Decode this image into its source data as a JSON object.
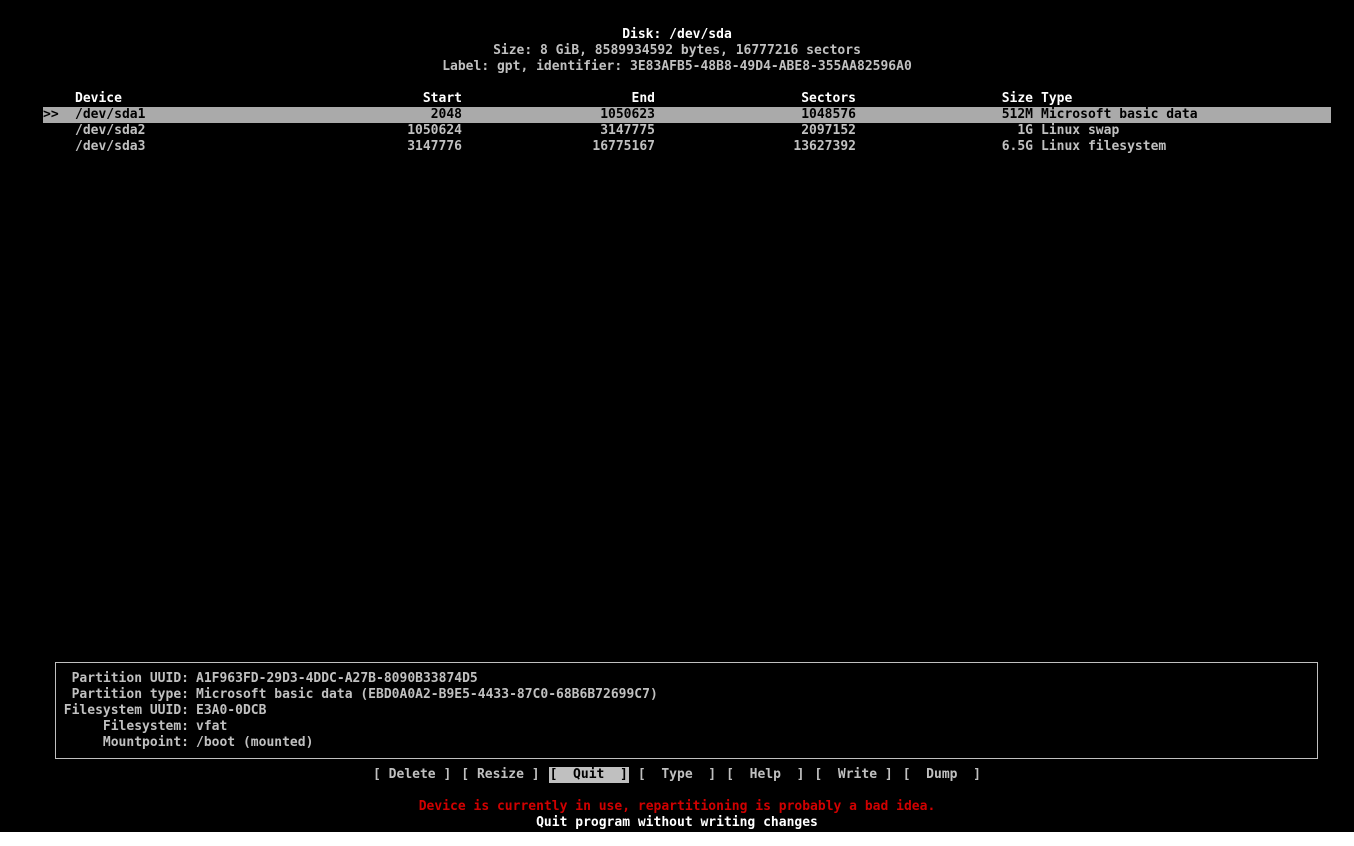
{
  "header": {
    "disk_line": "Disk: /dev/sda",
    "size_line": "Size: 8 GiB, 8589934592 bytes, 16777216 sectors",
    "label_line": "Label: gpt, identifier: 3E83AFB5-48B8-49D4-ABE8-355AA82596A0"
  },
  "table": {
    "columns": {
      "device": "Device",
      "start": "Start",
      "end": "End",
      "sectors": "Sectors",
      "size": "Size",
      "type": "Type"
    },
    "cursor": ">>",
    "rows": [
      {
        "device": "/dev/sda1",
        "start": "2048",
        "end": "1050623",
        "sectors": "1048576",
        "size": "512M",
        "type": "Microsoft basic data",
        "selected": true
      },
      {
        "device": "/dev/sda2",
        "start": "1050624",
        "end": "3147775",
        "sectors": "2097152",
        "size": "1G",
        "type": "Linux swap",
        "selected": false
      },
      {
        "device": "/dev/sda3",
        "start": "3147776",
        "end": "16775167",
        "sectors": "13627392",
        "size": "6.5G",
        "type": "Linux filesystem",
        "selected": false
      }
    ]
  },
  "info": {
    "partition_uuid_label": "Partition UUID:",
    "partition_uuid": "A1F963FD-29D3-4DDC-A27B-8090B33874D5",
    "partition_type_label": "Partition type:",
    "partition_type": "Microsoft basic data (EBD0A0A2-B9E5-4433-87C0-68B6B72699C7)",
    "filesystem_uuid_label": "Filesystem UUID:",
    "filesystem_uuid": "E3A0-0DCB",
    "filesystem_label": "Filesystem:",
    "filesystem": "vfat",
    "mountpoint_label": "Mountpoint:",
    "mountpoint": "/boot (mounted)"
  },
  "menu": {
    "items": [
      {
        "label": "[ Delete ]",
        "active": false
      },
      {
        "label": "[ Resize ]",
        "active": false
      },
      {
        "label": "[  Quit  ]",
        "active": true
      },
      {
        "label": "[  Type  ]",
        "active": false
      },
      {
        "label": "[  Help  ]",
        "active": false
      },
      {
        "label": "[  Write ]",
        "active": false
      },
      {
        "label": "[  Dump  ]",
        "active": false
      }
    ]
  },
  "status": {
    "warning": "Device is currently in use, repartitioning is probably a bad idea.",
    "hint": "Quit program without writing changes"
  },
  "colors": {
    "background": "#000000",
    "text": "#c0c0c0",
    "selection": "#aaaaaa",
    "warning": "#d00000"
  }
}
